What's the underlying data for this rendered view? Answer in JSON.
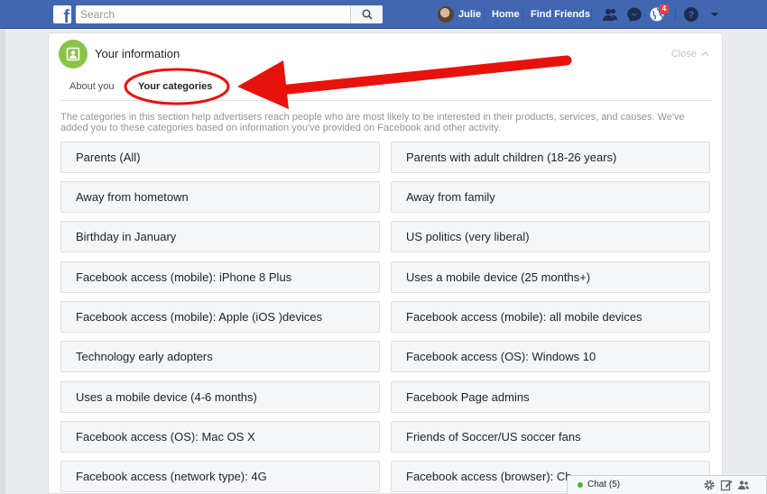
{
  "topbar": {
    "logo": "f",
    "search_placeholder": "Search",
    "user_name": "Julie",
    "home_label": "Home",
    "find_friends_label": "Find Friends",
    "notification_count": "4",
    "brand_color": "#4267b2"
  },
  "panel": {
    "title": "Your information",
    "close_label": "Close",
    "tabs": [
      "About you",
      "Your categories"
    ],
    "active_tab": "Your categories",
    "description": "The categories in this section help advertisers reach people who are most likely to be interested in their products, services, and causes. We've added you to these categories based on information you've provided on Facebook and other activity.",
    "categories_left": [
      "Parents (All)",
      "Away from hometown",
      "Birthday in January",
      "Facebook access (mobile): iPhone 8 Plus",
      "Facebook access (mobile): Apple (iOS )devices",
      "Technology early adopters",
      "Uses a mobile device (4-6 months)",
      "Facebook access (OS): Mac OS X",
      "Facebook access (network type): 4G"
    ],
    "categories_right": [
      "Parents with adult children (18-26 years)",
      "Away from family",
      "US politics (very liberal)",
      "Uses a mobile device (25 months+)",
      "Facebook access (mobile): all mobile devices",
      "Facebook access (OS): Windows 10",
      "Facebook Page admins",
      "Friends of Soccer/US soccer fans",
      "Facebook access (browser): Ch"
    ]
  },
  "chat": {
    "label": "Chat (5)",
    "status_color": "#42b72a"
  },
  "annotation": {
    "color": "#e8120c",
    "shape": "ellipse-and-arrow",
    "target": "Your categories"
  }
}
